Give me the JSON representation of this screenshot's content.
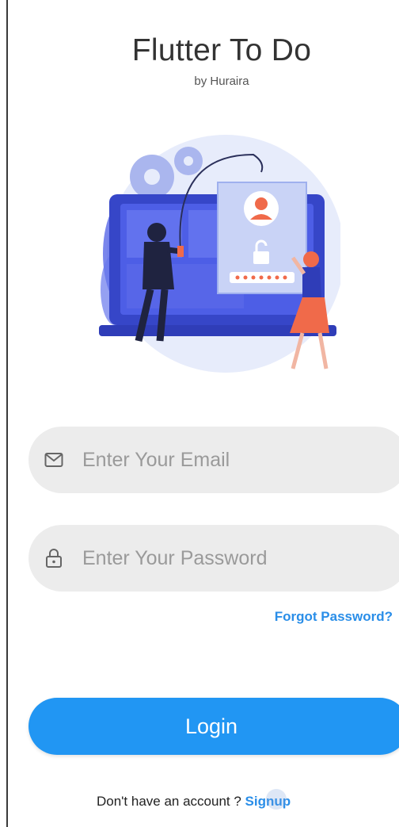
{
  "header": {
    "title": "Flutter To Do",
    "subtitle": "by Huraira"
  },
  "illustration": {
    "name": "login-hacker-illustration",
    "password_dots": 7
  },
  "email_field": {
    "value": "",
    "placeholder": "Enter Your Email",
    "icon": "mail-icon"
  },
  "password_field": {
    "value": "",
    "placeholder": "Enter Your Password",
    "icon": "lock-icon"
  },
  "forgot_password": {
    "label": "Forgot Password?"
  },
  "login_button": {
    "label": "Login"
  },
  "signup": {
    "prompt": "Don't have an account ? ",
    "link": "Signup"
  },
  "colors": {
    "accent": "#2196f3",
    "link": "#2a8ee8",
    "field_bg": "#ececec",
    "illustration_primary": "#4d5ee6",
    "illustration_accent": "#f06a4a"
  }
}
